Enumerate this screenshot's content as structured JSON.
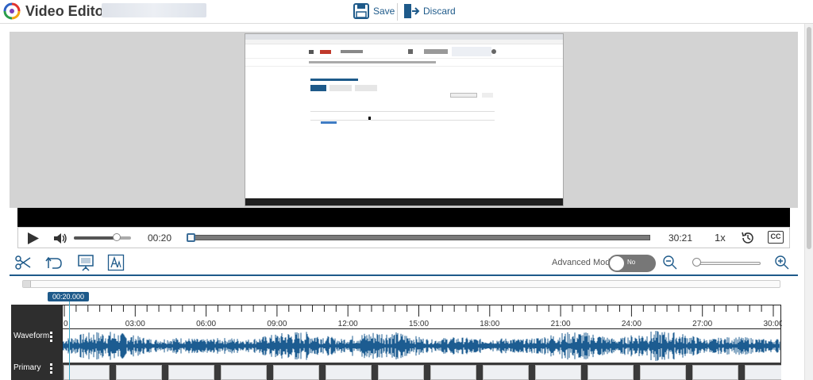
{
  "header": {
    "title": "Video Editor :",
    "save_label": "Save",
    "discard_label": "Discard"
  },
  "player": {
    "current_time": "00:20",
    "duration": "30:21",
    "speed": "1x",
    "cc_label": "CC",
    "volume_level": 0.75,
    "progress": 0.011
  },
  "toolbar": {
    "advanced_mode_label": "Advanced Mode",
    "toggle_label": "No",
    "zoom_level": 0.0
  },
  "timeline": {
    "playhead_time": "00:20.000",
    "ruler_labels": [
      "0",
      "03:00",
      "06:00",
      "09:00",
      "12:00",
      "15:00",
      "18:00",
      "21:00",
      "24:00",
      "27:00",
      "30:00"
    ],
    "tracks": [
      {
        "label": "Waveform"
      },
      {
        "label": "Primary"
      }
    ]
  },
  "colors": {
    "accent": "#1e5a8a",
    "waveform": "#1c5c91",
    "playhead": "#3fa9c9"
  }
}
